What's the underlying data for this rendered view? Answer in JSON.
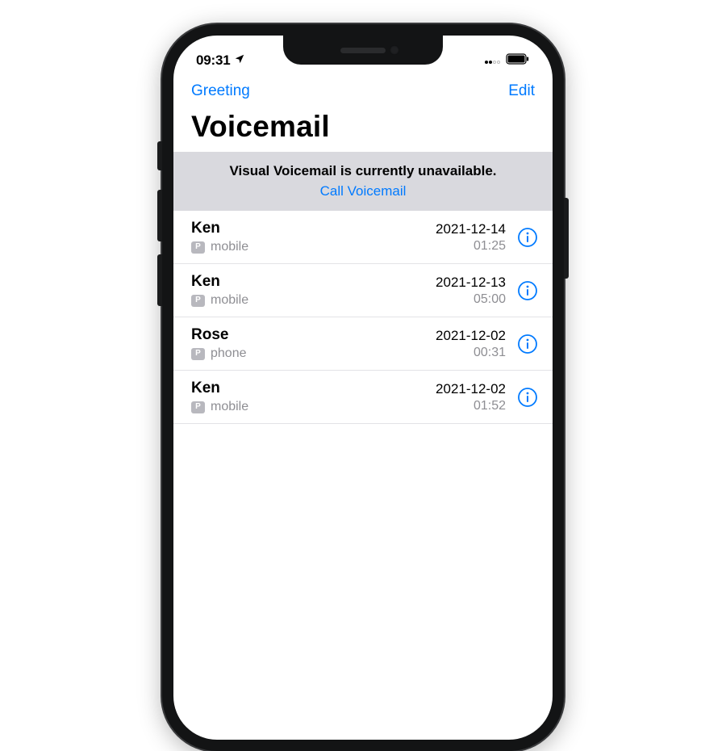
{
  "status": {
    "time": "09:31",
    "location_arrow": true,
    "cellular_bars": 2,
    "battery_pct": 95
  },
  "nav": {
    "left": "Greeting",
    "right": "Edit"
  },
  "title": "Voicemail",
  "notice": {
    "message": "Visual Voicemail is currently unavailable.",
    "action": "Call Voicemail"
  },
  "voicemails": [
    {
      "name": "Ken",
      "badge": "P",
      "label": "mobile",
      "date": "2021-12-14",
      "duration": "01:25"
    },
    {
      "name": "Ken",
      "badge": "P",
      "label": "mobile",
      "date": "2021-12-13",
      "duration": "05:00"
    },
    {
      "name": "Rose",
      "badge": "P",
      "label": "phone",
      "date": "2021-12-02",
      "duration": "00:31"
    },
    {
      "name": "Ken",
      "badge": "P",
      "label": "mobile",
      "date": "2021-12-02",
      "duration": "01:52"
    }
  ],
  "colors": {
    "accent": "#007aff",
    "subtext": "#8e8e93",
    "banner_bg": "#d9d9de"
  }
}
